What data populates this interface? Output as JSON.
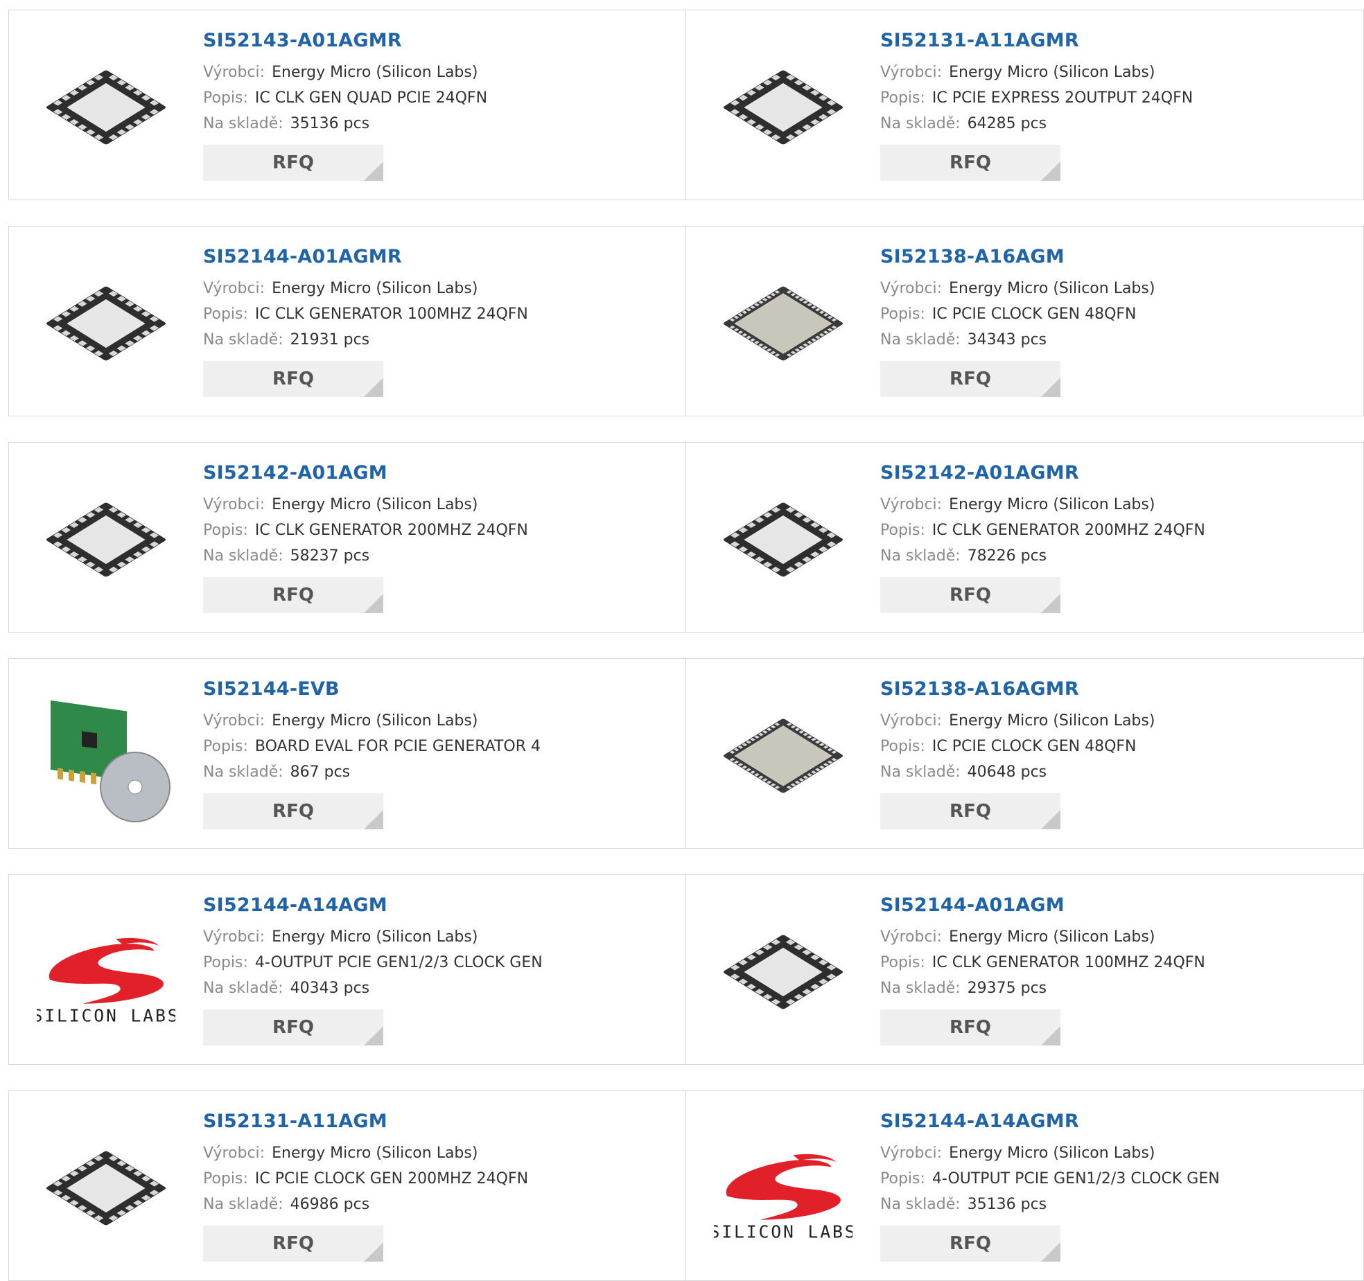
{
  "labels": {
    "manufacturer": "Výrobci:",
    "description": "Popis:",
    "stock": "Na skladě:",
    "rfq": "RFQ"
  },
  "products": [
    {
      "part": "SI52143-A01AGMR",
      "manufacturer": "Energy Micro (Silicon Labs)",
      "description": "IC CLK GEN QUAD PCIE 24QFN",
      "stock": "35136 pcs",
      "image": "qfn24-chip-icon"
    },
    {
      "part": "SI52131-A11AGMR",
      "manufacturer": "Energy Micro (Silicon Labs)",
      "description": "IC PCIE EXPRESS 2OUTPUT 24QFN",
      "stock": "64285 pcs",
      "image": "qfn24-chip-icon"
    },
    {
      "part": "SI52144-A01AGMR",
      "manufacturer": "Energy Micro (Silicon Labs)",
      "description": "IC CLK GENERATOR 100MHZ 24QFN",
      "stock": "21931 pcs",
      "image": "qfn24-chip-icon"
    },
    {
      "part": "SI52138-A16AGM",
      "manufacturer": "Energy Micro (Silicon Labs)",
      "description": "IC PCIE CLOCK GEN 48QFN",
      "stock": "34343 pcs",
      "image": "qfn48-chip-icon"
    },
    {
      "part": "SI52142-A01AGM",
      "manufacturer": "Energy Micro (Silicon Labs)",
      "description": "IC CLK GENERATOR 200MHZ 24QFN",
      "stock": "58237 pcs",
      "image": "qfn24-chip-icon"
    },
    {
      "part": "SI52142-A01AGMR",
      "manufacturer": "Energy Micro (Silicon Labs)",
      "description": "IC CLK GENERATOR 200MHZ 24QFN",
      "stock": "78226 pcs",
      "image": "qfn24-chip-icon"
    },
    {
      "part": "SI52144-EVB",
      "manufacturer": "Energy Micro (Silicon Labs)",
      "description": "BOARD EVAL FOR PCIE GENERATOR 4",
      "stock": "867 pcs",
      "image": "eval-board-icon"
    },
    {
      "part": "SI52138-A16AGMR",
      "manufacturer": "Energy Micro (Silicon Labs)",
      "description": "IC PCIE CLOCK GEN 48QFN",
      "stock": "40648 pcs",
      "image": "qfn48-chip-icon"
    },
    {
      "part": "SI52144-A14AGM",
      "manufacturer": "Energy Micro (Silicon Labs)",
      "description": "4-OUTPUT PCIE GEN1/2/3 CLOCK GEN",
      "stock": "40343 pcs",
      "image": "silicon-labs-logo"
    },
    {
      "part": "SI52144-A01AGM",
      "manufacturer": "Energy Micro (Silicon Labs)",
      "description": "IC CLK GENERATOR 100MHZ 24QFN",
      "stock": "29375 pcs",
      "image": "qfn24-chip-icon"
    },
    {
      "part": "SI52131-A11AGM",
      "manufacturer": "Energy Micro (Silicon Labs)",
      "description": "IC PCIE CLOCK GEN 200MHZ 24QFN",
      "stock": "46986 pcs",
      "image": "qfn24-chip-icon"
    },
    {
      "part": "SI52144-A14AGMR",
      "manufacturer": "Energy Micro (Silicon Labs)",
      "description": "4-OUTPUT PCIE GEN1/2/3 CLOCK GEN",
      "stock": "35136 pcs",
      "image": "silicon-labs-logo"
    }
  ],
  "logo_text": "SILICON LABS",
  "colors": {
    "link": "#1f63a8",
    "label": "#8a8a8a",
    "value": "#333333",
    "rfq_bg": "#efefef",
    "border": "#d6d6d6",
    "logo_red": "#e2202a"
  }
}
